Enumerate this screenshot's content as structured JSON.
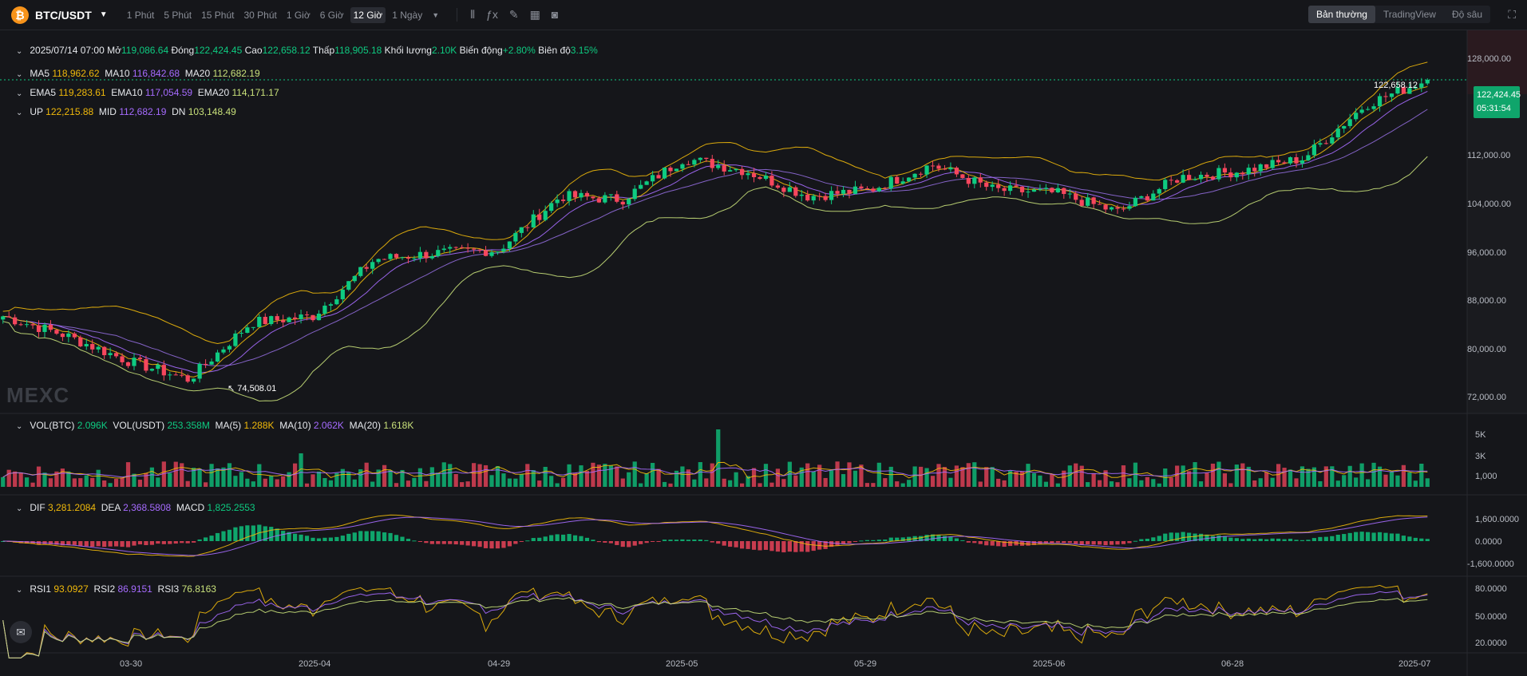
{
  "header": {
    "coin_letter": "₿",
    "pair": "BTC/USDT",
    "timeframes": [
      "1 Phút",
      "5 Phút",
      "15 Phút",
      "30 Phút",
      "1 Giờ",
      "6 Giờ",
      "12 Giờ",
      "1 Ngày"
    ],
    "active_timeframe": "12 Giờ",
    "views": [
      "Bản thường",
      "TradingView",
      "Độ sâu"
    ],
    "active_view": "Bản thường"
  },
  "ohlc": {
    "date": "2025/07/14 07:00",
    "open_label": "Mở",
    "open": "119,086.64",
    "close_label": "Đóng",
    "close": "122,424.45",
    "high_label": "Cao",
    "high": "122,658.12",
    "low_label": "Thấp",
    "low": "118,905.18",
    "vol_label": "Khối lượng",
    "vol": "2.10K",
    "change_label": "Biến động",
    "change": "+2.80%",
    "amp_label": "Biên độ",
    "amp": "3.15%"
  },
  "ma": {
    "ma5_label": "MA5",
    "ma5": "118,962.62",
    "ma10_label": "MA10",
    "ma10": "116,842.68",
    "ma20_label": "MA20",
    "ma20": "112,682.19"
  },
  "ema": {
    "ema5_label": "EMA5",
    "ema5": "119,283.61",
    "ema10_label": "EMA10",
    "ema10": "117,054.59",
    "ema20_label": "EMA20",
    "ema20": "114,171.17"
  },
  "boll": {
    "up_label": "UP",
    "up": "122,215.88",
    "mid_label": "MID",
    "mid": "112,682.19",
    "dn_label": "DN",
    "dn": "103,148.49"
  },
  "volume": {
    "btc_label": "VOL(BTC)",
    "btc": "2.096K",
    "usdt_label": "VOL(USDT)",
    "usdt": "253.358M",
    "ma5_label": "MA(5)",
    "ma5": "1.288K",
    "ma10_label": "MA(10)",
    "ma10": "2.062K",
    "ma20_label": "MA(20)",
    "ma20": "1.618K"
  },
  "macd": {
    "dif_label": "DIF",
    "dif": "3,281.2084",
    "dea_label": "DEA",
    "dea": "2,368.5808",
    "macd_label": "MACD",
    "macd": "1,825.2553"
  },
  "rsi": {
    "rsi1_label": "RSI1",
    "rsi1": "93.0927",
    "rsi2_label": "RSI2",
    "rsi2": "86.9151",
    "rsi3_label": "RSI3",
    "rsi3": "76.8163"
  },
  "price_axis": [
    "128,000.00",
    "112,000.00",
    "104,000.00",
    "96,000.00",
    "88,000.00",
    "80,000.00",
    "72,000.00"
  ],
  "volume_axis": [
    "5K",
    "3K",
    "1,000"
  ],
  "macd_axis": [
    "1,600.0000",
    "0.0000",
    "-1,600.0000"
  ],
  "rsi_axis": [
    "80.0000",
    "50.0000",
    "20.0000"
  ],
  "x_axis": [
    "03-30",
    "2025-04",
    "04-29",
    "2025-05",
    "05-29",
    "2025-06",
    "06-28",
    "2025-07"
  ],
  "current_price": "122,424.45",
  "countdown": "05:31:54",
  "high_marker": "122,658.12",
  "low_marker": "74,508.01",
  "watermark": "MEXC",
  "colors": {
    "up": "#0ecb81",
    "down": "#f6465d",
    "ma5": "#f0b90b",
    "ma10": "#a66bff",
    "ma20": "#c8e07a",
    "bg": "#15161a"
  },
  "chart_data": {
    "type": "candlestick",
    "price_range": [
      70000,
      130000
    ],
    "x": [
      "03-30",
      "2025-04",
      "04-29",
      "2025-05",
      "05-29",
      "2025-06",
      "06-28",
      "2025-07"
    ],
    "key_closes": [
      85000,
      82000,
      78000,
      75000,
      84000,
      85000,
      94000,
      95000,
      95500,
      104000,
      103500,
      110000,
      108000,
      104000,
      105000,
      109000,
      105000,
      104500,
      101500,
      107000,
      108000,
      110000,
      118500,
      122424.45
    ],
    "high": 122658.12,
    "low": 74508.01
  }
}
